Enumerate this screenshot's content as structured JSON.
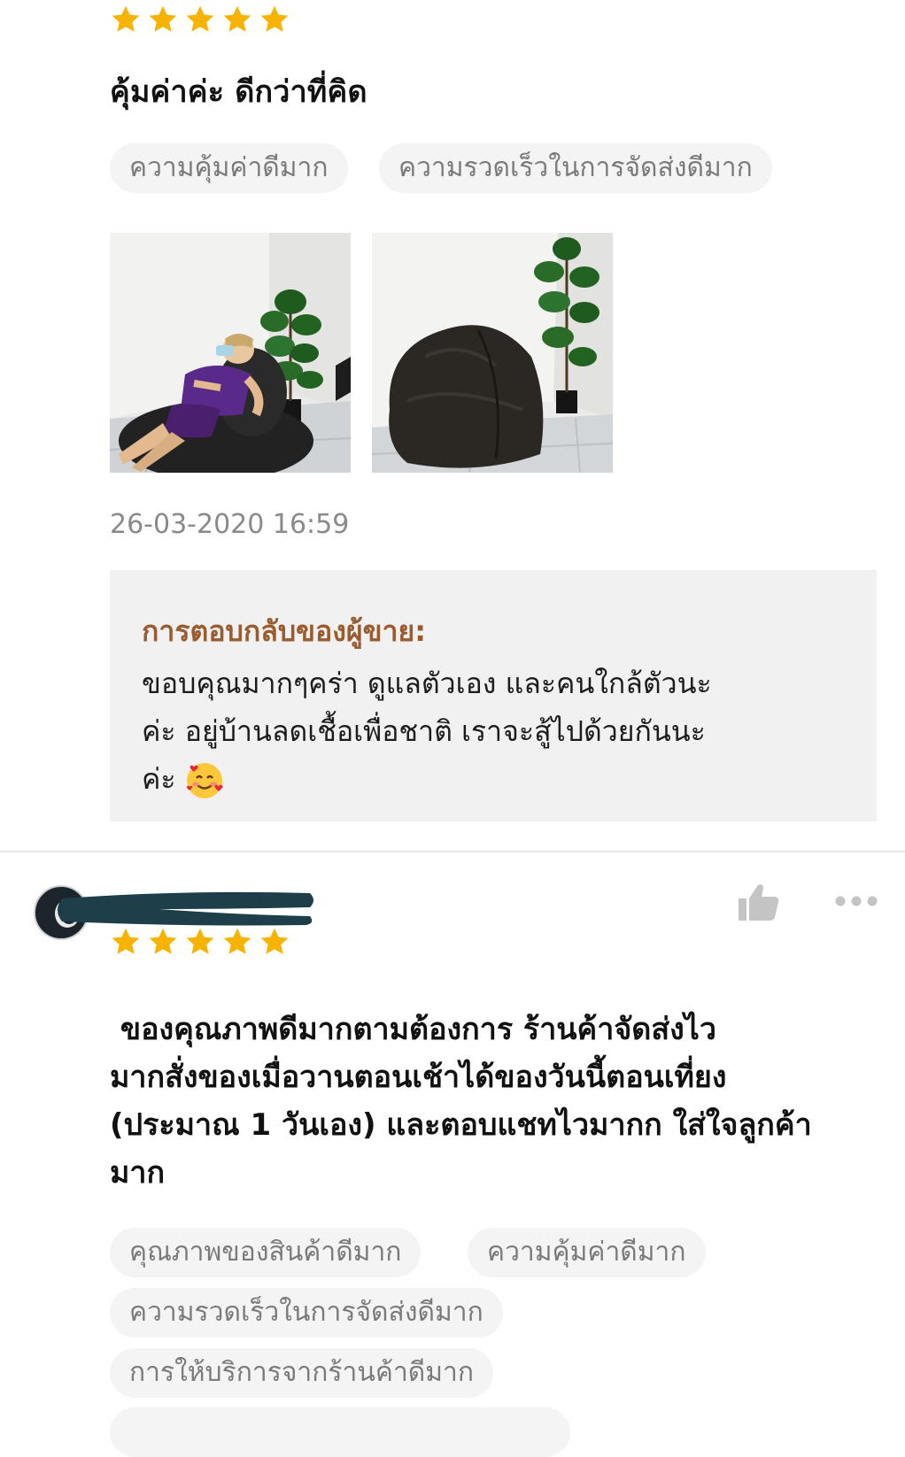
{
  "review1": {
    "rating": 5,
    "title": "คุ้มค่าค่ะ ดีกว่าที่คิด",
    "tags": [
      "ความคุ้มค่าดีมาก",
      "ความรวดเร็วในการจัดส่งดีมาก"
    ],
    "timestamp": "26-03-2020 16:59",
    "seller_reply": {
      "heading": "การตอบกลับของผู้ขาย:",
      "line1": "ขอบคุณมากๆคร่า ดูแลตัวเอง และคนใกล้ตัวนะ",
      "line2": "ค่ะ อยู่บ้านลดเชื้อเพื่อชาติ เราจะสู้ไปด้วยกันนะ",
      "line3": "ค่ะ"
    }
  },
  "review2": {
    "rating": 5,
    "text": [
      " ของคุณภาพดีมากตามต้องการ ร้านค้าจัดส่งไว",
      "มากสั่งของเมื่อวานตอนเช้าได้ของวันนี้ตอนเที่ยง",
      "(ประมาณ 1 วันเอง) และตอบแชทไวมากก ใส่ใจลูกค้า",
      "มาก"
    ],
    "tags": [
      "คุณภาพของสินค้าดีมาก",
      "ความคุ้มค่าดีมาก",
      "ความรวดเร็วในการจัดส่งดีมาก",
      "การให้บริการจากร้านค้าดีมาก"
    ]
  },
  "colors": {
    "star": "#f6b400",
    "tag_bg": "#f4f4f4",
    "reply_heading": "#9a5b2e",
    "icon_gray": "#c4c4c4"
  }
}
